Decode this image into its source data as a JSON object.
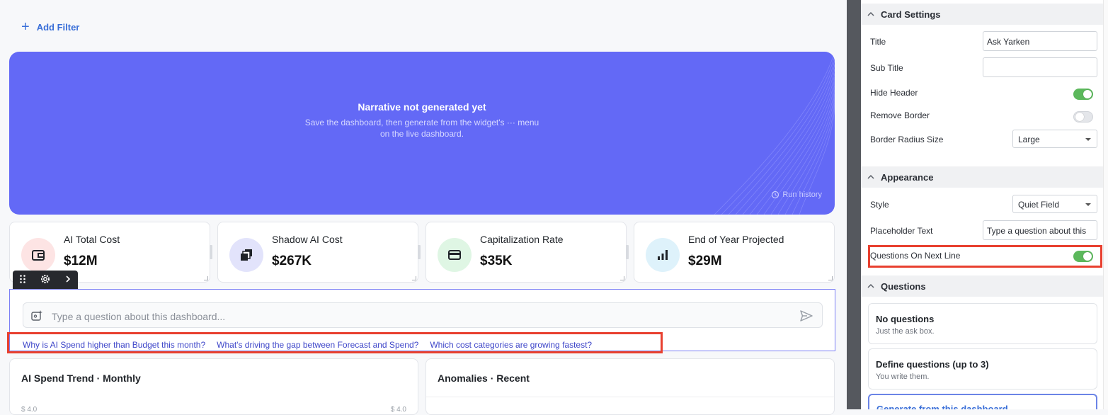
{
  "toolbar": {
    "add_filter_label": "Add Filter"
  },
  "narrative": {
    "title": "Narrative not generated yet",
    "subtitle": "Save the dashboard, then generate from the widget's ··· menu on the live dashboard.",
    "run_history_label": "Run history"
  },
  "kpis": [
    {
      "label": "AI Total Cost",
      "value": "$12M",
      "icon": "wallet-icon",
      "bg": "#fde4e4"
    },
    {
      "label": "Shadow AI Cost",
      "value": "$267K",
      "icon": "layers-icon",
      "bg": "#e2e3fb"
    },
    {
      "label": "Capitalization Rate",
      "value": "$35K",
      "icon": "credit-card-icon",
      "bg": "#dff6e4"
    },
    {
      "label": "End of Year Projected",
      "value": "$29M",
      "icon": "bar-chart-icon",
      "bg": "#def2fb"
    }
  ],
  "ask": {
    "placeholder": "Type a question about this dashboard...",
    "questions": [
      "Why is AI Spend higher than Budget this month?",
      "What's driving the gap between Forecast and Spend?",
      "Which cost categories are growing fastest?"
    ]
  },
  "cards": [
    {
      "title": "AI Spend Trend · Monthly",
      "axis_left": "$ 4.0",
      "axis_right": "$ 4.0"
    },
    {
      "title": "Anomalies · Recent"
    }
  ],
  "panel": {
    "card_settings": {
      "header": "Card Settings",
      "title_label": "Title",
      "title_value": "Ask Yarken",
      "subtitle_label": "Sub Title",
      "subtitle_value": "",
      "hide_header_label": "Hide Header",
      "hide_header": true,
      "remove_border_label": "Remove Border",
      "remove_border": false,
      "radius_label": "Border Radius Size",
      "radius_value": "Large"
    },
    "appearance": {
      "header": "Appearance",
      "style_label": "Style",
      "style_value": "Quiet Field",
      "placeholder_label": "Placeholder Text",
      "placeholder_value": "Type a question about this",
      "next_line_label": "Questions On Next Line",
      "next_line": true
    },
    "questions": {
      "header": "Questions",
      "options": [
        {
          "title": "No questions",
          "desc": "Just the ask box."
        },
        {
          "title": "Define questions (up to 3)",
          "desc": "You write them."
        },
        {
          "title": "Generate from this dashboard",
          "desc": ""
        }
      ]
    }
  },
  "colors": {
    "hero": "#6369f6",
    "accent": "#3a6fd8",
    "highlight": "#e8402f",
    "toggle_on": "#5cb85c"
  }
}
